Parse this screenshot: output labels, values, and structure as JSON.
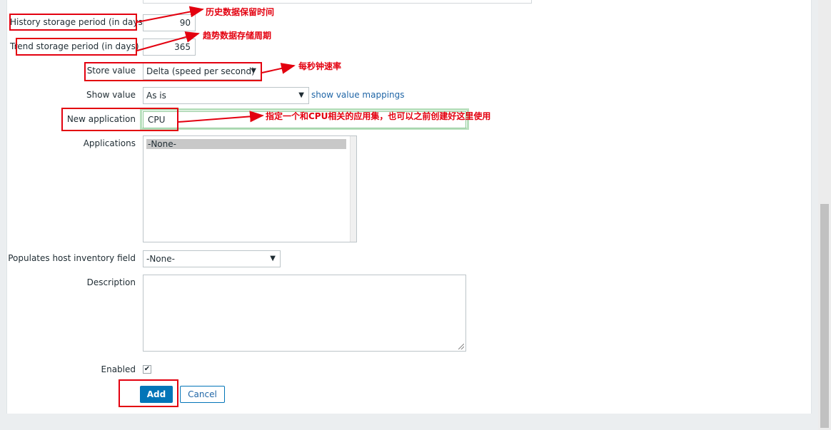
{
  "form": {
    "history": {
      "label": "History storage period (in days)",
      "value": "90"
    },
    "trend": {
      "label": "Trend storage period (in days)",
      "value": "365"
    },
    "store_value": {
      "label": "Store value",
      "selected": "Delta (speed per second)"
    },
    "show_value": {
      "label": "Show value",
      "selected": "As is",
      "link": "show value mappings"
    },
    "new_application": {
      "label": "New application",
      "value": "CPU"
    },
    "applications": {
      "label": "Applications",
      "options": [
        "-None-"
      ]
    },
    "inventory": {
      "label": "Populates host inventory field",
      "selected": "-None-"
    },
    "description": {
      "label": "Description",
      "value": ""
    },
    "enabled": {
      "label": "Enabled",
      "checked": true,
      "check_glyph": "✔"
    },
    "buttons": {
      "add": "Add",
      "cancel": "Cancel"
    },
    "caret_glyph": "▼"
  },
  "annotations": {
    "history": "历史数据保留时间",
    "trend": "趋势数据存储周期",
    "store_value": "每秒钟速率",
    "new_application": "指定一个和CPU相关的应用集，也可以之前创建好这里使用"
  },
  "colors": {
    "annotation_red": "#e3000f",
    "primary_button": "#0275b8",
    "link": "#1f65a6",
    "highlight_green": "#b9e0be"
  }
}
